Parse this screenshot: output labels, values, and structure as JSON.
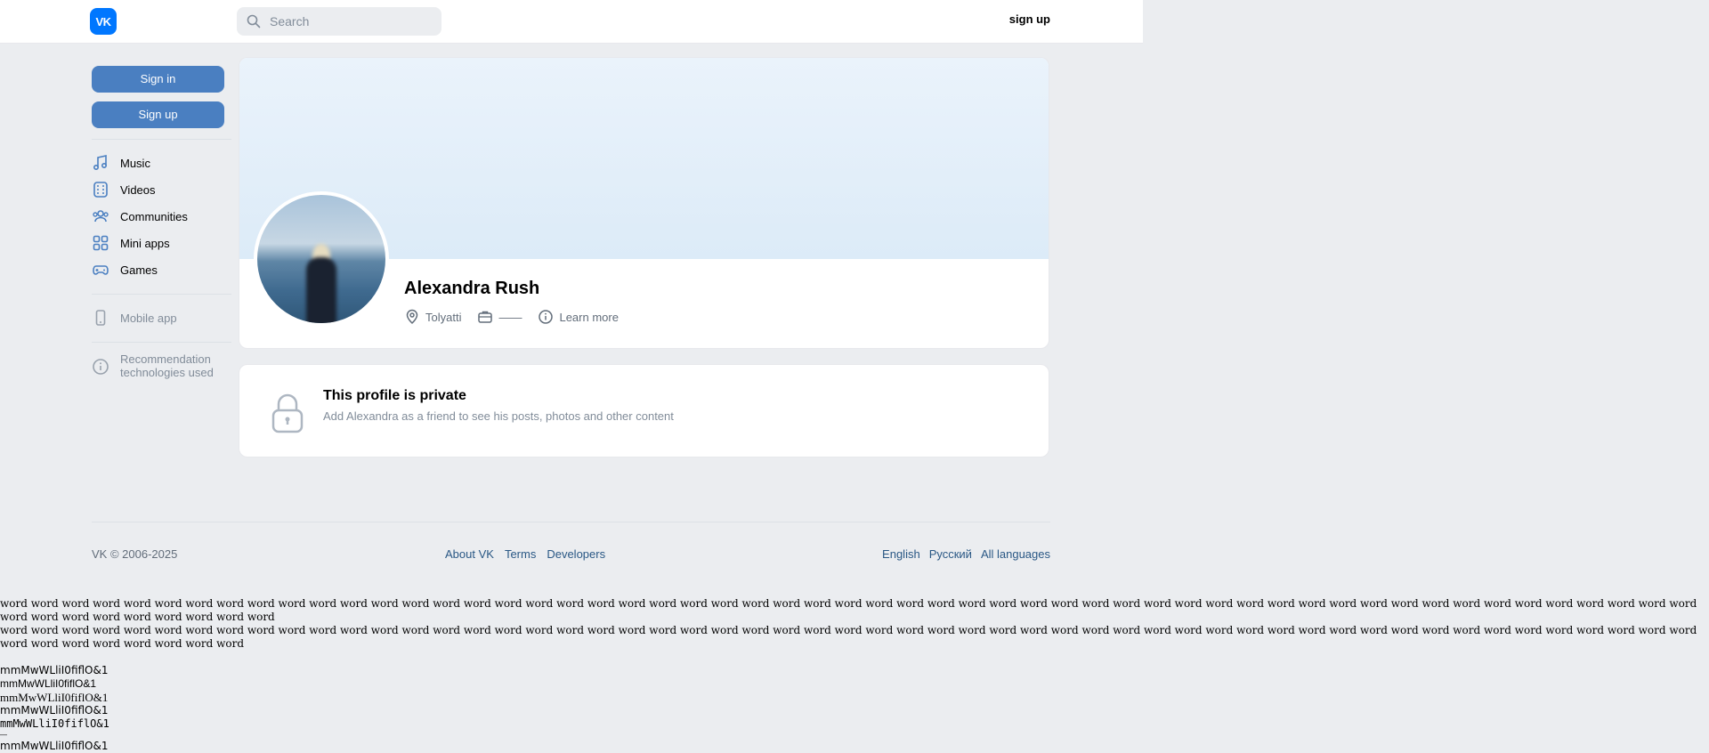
{
  "header": {
    "logo_text": "VK",
    "search_placeholder": "Search",
    "signup_label": "sign up"
  },
  "sidebar": {
    "sign_in": "Sign in",
    "sign_up": "Sign up",
    "items": [
      {
        "label": "Music",
        "icon": "music-icon"
      },
      {
        "label": "Videos",
        "icon": "video-icon"
      },
      {
        "label": "Communities",
        "icon": "communities-icon"
      },
      {
        "label": "Mini apps",
        "icon": "mini-apps-icon"
      },
      {
        "label": "Games",
        "icon": "gamepad-icon"
      }
    ],
    "mobile_app": "Mobile app",
    "recommendation": "Recommendation technologies used"
  },
  "profile": {
    "name": "Alexandra Rush",
    "city": "Tolyatti",
    "work": "——",
    "learn_more": "Learn more"
  },
  "private": {
    "title": "This profile is private",
    "description": "Add Alexandra as a friend to see his posts, photos and other content"
  },
  "footer": {
    "copyright": "VK © 2006-2025",
    "links": [
      "About VK",
      "Terms",
      "Developers"
    ],
    "languages": [
      "English",
      "Русский",
      "All languages"
    ]
  },
  "test_text": {
    "words_line1": "word word word word word word word word word word word word word word word word word word word word word word word word word word word word word word word word word word word word word word word word word word word word word word word word word word word word word word word word word word word word word word word word",
    "words_line2": "word word word word word word word word word word word word word word word word word word word word word word word word word word word word word word word word word word word word word word word word word word word word word word word word word word word word word word word word word word word word word word word",
    "samples": [
      "mmMwWLliI0fiflO&1",
      "mmMwWLliI0fiflO&1",
      "mmMwWLliI0fiflO&1",
      "mmMwWLliI0fiflO&1",
      "mmMwWLliI0fiflO&1",
      "mmMwWLliI0fiflO&1"
    ]
  },
  "colors": {
    "accent": "#4a7fc1",
    "logo": "#0077ff",
    "background": "#ebedf0",
    "link": "#2a5885"
  }
}
